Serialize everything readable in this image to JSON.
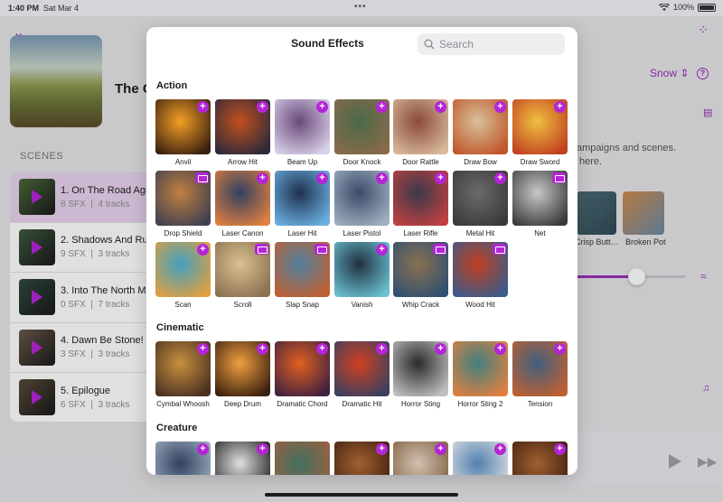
{
  "status": {
    "time": "1:40 PM",
    "date": "Sat Mar 4",
    "battery": "100%"
  },
  "background": {
    "title": "The C",
    "snow_label": "Snow",
    "campaigns_line1": "ampaigns and scenes.",
    "campaigns_line2": "here.",
    "scenes_header": "SCENES",
    "scenes": [
      {
        "name": "1. On The Road Aga",
        "sfx": "8 SFX",
        "tracks": "4 tracks",
        "selected": true,
        "color": "#4a6b3a"
      },
      {
        "name": "2. Shadows And Ru",
        "sfx": "9 SFX",
        "tracks": "3 tracks",
        "selected": false,
        "color": "#3f5a40"
      },
      {
        "name": "3. Into The North M",
        "sfx": "0 SFX",
        "tracks": "7 tracks",
        "selected": false,
        "color": "#2f4a3f"
      },
      {
        "name": "4. Dawn Be Stone!",
        "sfx": "3 SFX",
        "tracks": "3 tracks",
        "selected": false,
        "color": "#6a5a4a"
      },
      {
        "name": "5. Epilogue",
        "sfx": "6 SFX",
        "tracks": "3 tracks",
        "selected": false,
        "color": "#5a4a3a"
      }
    ],
    "panel_labels": [
      "Crisp Butt…",
      "Broken Pot"
    ],
    "volume": 0.55
  },
  "modal": {
    "title": "Sound Effects",
    "search_placeholder": "Search",
    "sections": [
      {
        "name": "Action",
        "items": [
          {
            "label": "Anvil",
            "badge": "add",
            "c1": "#f4a025",
            "c2": "#3a2010"
          },
          {
            "label": "Arrow Hit",
            "badge": "add",
            "c1": "#c2501e",
            "c2": "#2c2a3a"
          },
          {
            "label": "Beam Up",
            "badge": "add",
            "c1": "#6a4a7a",
            "c2": "#d8d0e8"
          },
          {
            "label": "Door Knock",
            "badge": "add",
            "c1": "#4a6a4a",
            "c2": "#8a6a4a"
          },
          {
            "label": "Door Rattle",
            "badge": "add",
            "c1": "#8a4a3a",
            "c2": "#d8b89a"
          },
          {
            "label": "Draw Bow",
            "badge": "add",
            "c1": "#d8c09a",
            "c2": "#c0562a"
          },
          {
            "label": "Draw Sword",
            "badge": "add",
            "c1": "#f0c040",
            "c2": "#c04020"
          },
          {
            "label": "Drop Shield",
            "badge": "pic",
            "c1": "#c08040",
            "c2": "#404050"
          },
          {
            "label": "Laser Canon",
            "badge": "add",
            "c1": "#304060",
            "c2": "#e08040"
          },
          {
            "label": "Laser Hit",
            "badge": "add",
            "c1": "#203050",
            "c2": "#6ab0e0"
          },
          {
            "label": "Laser Pistol",
            "badge": "add",
            "c1": "#3a4a6a",
            "c2": "#a0b0c0"
          },
          {
            "label": "Laser Rifle",
            "badge": "add",
            "c1": "#3a3a4a",
            "c2": "#c04040"
          },
          {
            "label": "Metal Hit",
            "badge": "add",
            "c1": "#6a6a6a",
            "c2": "#3a3a3a"
          },
          {
            "label": "Net",
            "badge": "pic",
            "c1": "#c8c8c8",
            "c2": "#3a3a3a"
          },
          {
            "label": "Scan",
            "badge": "add",
            "c1": "#40a0c0",
            "c2": "#e0a040"
          },
          {
            "label": "Scroll",
            "badge": "pic",
            "c1": "#d8c090",
            "c2": "#8a7050"
          },
          {
            "label": "Slap Snap",
            "badge": "pic",
            "c1": "#5080a0",
            "c2": "#c06030"
          },
          {
            "label": "Vanish",
            "badge": "add",
            "c1": "#203040",
            "c2": "#6ac0d0"
          },
          {
            "label": "Whip Crack",
            "badge": "pic",
            "c1": "#8a7050",
            "c2": "#305070"
          },
          {
            "label": "Wood Hit",
            "badge": "pic",
            "c1": "#c04020",
            "c2": "#3a5a8a"
          }
        ]
      },
      {
        "name": "Cinematic",
        "items": [
          {
            "label": "Cymbal Whoosh",
            "badge": "add",
            "c1": "#c89040",
            "c2": "#4a3020"
          },
          {
            "label": "Deep Drum",
            "badge": "add",
            "c1": "#f0a040",
            "c2": "#3a2010"
          },
          {
            "label": "Dramatic Chord",
            "badge": "add",
            "c1": "#e06020",
            "c2": "#402040"
          },
          {
            "label": "Dramatic Hit",
            "badge": "add",
            "c1": "#d04020",
            "c2": "#3a4060"
          },
          {
            "label": "Horror Sting",
            "badge": "add",
            "c1": "#2a2a2a",
            "c2": "#c0c0c0"
          },
          {
            "label": "Horror Sting 2",
            "badge": "add",
            "c1": "#408080",
            "c2": "#e08040"
          },
          {
            "label": "Tension",
            "badge": "add",
            "c1": "#406080",
            "c2": "#c06030"
          }
        ]
      },
      {
        "name": "Creature",
        "items": [
          {
            "label": "",
            "badge": "add",
            "c1": "#304060",
            "c2": "#a0b0c0"
          },
          {
            "label": "",
            "badge": "add",
            "c1": "#e0e0e0",
            "c2": "#202020"
          },
          {
            "label": "",
            "badge": "none",
            "c1": "#407060",
            "c2": "#a06040"
          },
          {
            "label": "",
            "badge": "add",
            "c1": "#a06030",
            "c2": "#402010"
          },
          {
            "label": "",
            "badge": "add",
            "c1": "#d0c0b0",
            "c2": "#806040"
          },
          {
            "label": "",
            "badge": "add",
            "c1": "#5080b0",
            "c2": "#e0e0e0"
          },
          {
            "label": "",
            "badge": "add",
            "c1": "#a06030",
            "c2": "#402010"
          }
        ]
      }
    ]
  }
}
